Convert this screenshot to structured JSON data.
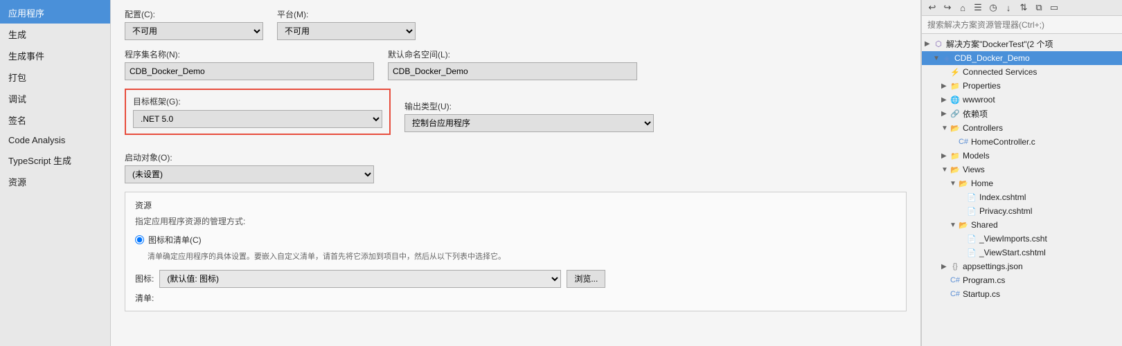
{
  "sidebar": {
    "items": [
      {
        "id": "app",
        "label": "应用程序",
        "active": true
      },
      {
        "id": "build",
        "label": "生成",
        "active": false
      },
      {
        "id": "build-events",
        "label": "生成事件",
        "active": false
      },
      {
        "id": "package",
        "label": "打包",
        "active": false
      },
      {
        "id": "debug",
        "label": "调试",
        "active": false
      },
      {
        "id": "sign",
        "label": "签名",
        "active": false
      },
      {
        "id": "code-analysis",
        "label": "Code Analysis",
        "active": false
      },
      {
        "id": "typescript",
        "label": "TypeScript 生成",
        "active": false
      },
      {
        "id": "resources",
        "label": "资源",
        "active": false
      }
    ]
  },
  "main": {
    "config_label": "配置(C):",
    "config_value": "不可用",
    "platform_label": "平台(M):",
    "platform_value": "不可用",
    "assembly_label": "程序集名称(N):",
    "assembly_value": "CDB_Docker_Demo",
    "namespace_label": "默认命名空间(L):",
    "namespace_value": "CDB_Docker_Demo",
    "framework_label": "目标框架(G):",
    "framework_value": ".NET 5.0",
    "output_label": "输出类型(U):",
    "output_value": "控制台应用程序",
    "startup_label": "启动对象(O):",
    "startup_value": "(未设置)",
    "resources_section": {
      "title": "资源",
      "desc": "指定应用程序资源的管理方式:",
      "radio_label": "图标和清单(C)",
      "sub_desc": "清单确定应用程序的具体设置。要嵌入自定义清单，请首先将它添加到项目中，然后从以下列表中选择它。",
      "icon_label": "图标:",
      "icon_value": "(默认值: 图标)",
      "browse_btn": "浏览...",
      "list_label": "清单:"
    }
  },
  "right_panel": {
    "search_placeholder": "搜索解决方案资源管理器(Ctrl+;)",
    "solution_label": "解决方案\"DockerTest\"(2 个项",
    "project_label": "CDB_Docker_Demo",
    "tree_items": [
      {
        "id": "connected-services",
        "label": "Connected Services",
        "indent": 2,
        "icon": "connected",
        "arrow": ""
      },
      {
        "id": "properties",
        "label": "Properties",
        "indent": 2,
        "icon": "folder",
        "arrow": "▶"
      },
      {
        "id": "wwwroot",
        "label": "wwwroot",
        "indent": 2,
        "icon": "globe",
        "arrow": "▶"
      },
      {
        "id": "deps",
        "label": "依赖项",
        "indent": 2,
        "icon": "deps",
        "arrow": "▶"
      },
      {
        "id": "controllers",
        "label": "Controllers",
        "indent": 2,
        "icon": "folder-open",
        "arrow": "▼"
      },
      {
        "id": "home-controller",
        "label": "HomeController.c",
        "indent": 3,
        "icon": "file-cs",
        "arrow": ""
      },
      {
        "id": "models",
        "label": "Models",
        "indent": 2,
        "icon": "folder",
        "arrow": "▶"
      },
      {
        "id": "views",
        "label": "Views",
        "indent": 2,
        "icon": "folder-open",
        "arrow": "▼"
      },
      {
        "id": "views-home",
        "label": "Home",
        "indent": 3,
        "icon": "folder-open",
        "arrow": "▼"
      },
      {
        "id": "index-cshtml",
        "label": "Index.cshtml",
        "indent": 4,
        "icon": "file-cshtml",
        "arrow": ""
      },
      {
        "id": "privacy-cshtml",
        "label": "Privacy.cshtml",
        "indent": 4,
        "icon": "file-cshtml",
        "arrow": ""
      },
      {
        "id": "shared",
        "label": "Shared",
        "indent": 3,
        "icon": "folder-open",
        "arrow": "▼"
      },
      {
        "id": "viewimports",
        "label": "_ViewImports.csht",
        "indent": 4,
        "icon": "file-cshtml",
        "arrow": ""
      },
      {
        "id": "viewstart",
        "label": "_ViewStart.cshtml",
        "indent": 4,
        "icon": "file-cshtml",
        "arrow": ""
      },
      {
        "id": "appsettings",
        "label": "appsettings.json",
        "indent": 2,
        "icon": "file-json",
        "arrow": "▶"
      },
      {
        "id": "program-cs",
        "label": "Program.cs",
        "indent": 2,
        "icon": "file-cs",
        "arrow": ""
      },
      {
        "id": "startup-cs",
        "label": "Startup.cs",
        "indent": 2,
        "icon": "file-cs",
        "arrow": ""
      }
    ]
  },
  "toolbar": {
    "icons": [
      "↩",
      "↪",
      "🏠",
      "📋",
      "🕐",
      "⬇",
      "↕",
      "📋",
      "□"
    ]
  }
}
